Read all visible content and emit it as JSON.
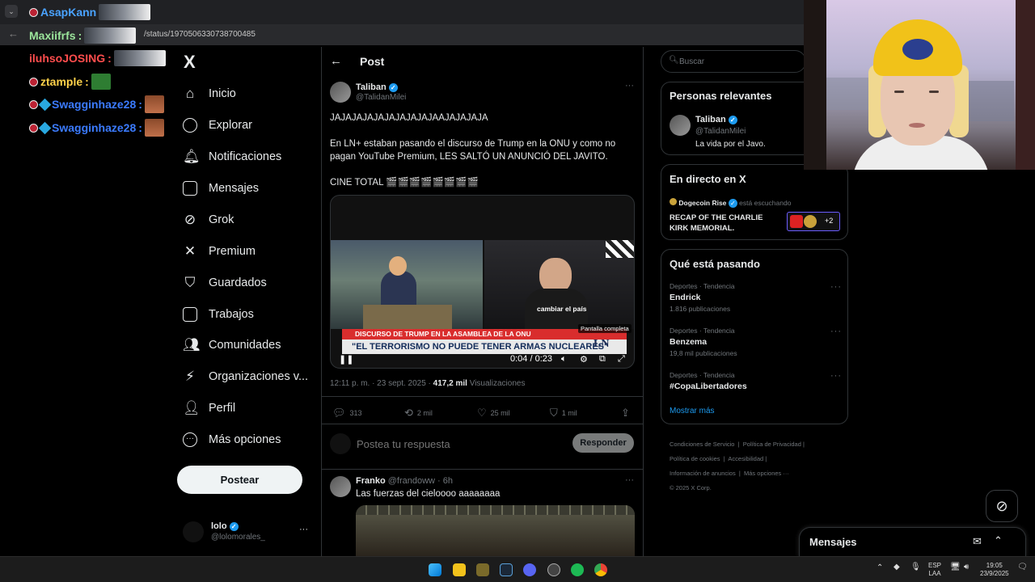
{
  "browser": {
    "url": "/status/1970506330738700485"
  },
  "chat": [
    {
      "user": "AsapKann",
      "color": "#4aa3ff"
    },
    {
      "user": "Maxiifrfs",
      "color": "#9be59b"
    },
    {
      "user": "iluhsoJOSING",
      "color": "#ff4d4d"
    },
    {
      "user": "ztample",
      "color": "#ffd24a"
    },
    {
      "user": "Swagginhaze28",
      "color": "#3b7bff"
    },
    {
      "user": "Swagginhaze28",
      "color": "#3b7bff"
    }
  ],
  "nav": {
    "logo": "X",
    "items": [
      {
        "label": "Inicio",
        "icon": "home-icon"
      },
      {
        "label": "Explorar",
        "icon": "search-icon"
      },
      {
        "label": "Notificaciones",
        "icon": "bell-icon"
      },
      {
        "label": "Mensajes",
        "icon": "mail-icon"
      },
      {
        "label": "Grok",
        "icon": "grok-icon"
      },
      {
        "label": "Premium",
        "icon": "x-icon"
      },
      {
        "label": "Guardados",
        "icon": "bookmark-icon"
      },
      {
        "label": "Trabajos",
        "icon": "briefcase-icon"
      },
      {
        "label": "Comunidades",
        "icon": "people-icon"
      },
      {
        "label": "Organizaciones v...",
        "icon": "lightning-icon"
      },
      {
        "label": "Perfil",
        "icon": "person-icon"
      },
      {
        "label": "Más opciones",
        "icon": "more-circle-icon"
      }
    ],
    "post_button": "Postear",
    "account": {
      "name": "lolo",
      "handle": "@lolomorales_"
    }
  },
  "main": {
    "header": "Post",
    "tweet": {
      "author": "Taliban",
      "handle": "@TalidanMilei",
      "line1": "JAJAJAJAJAJAJAJAJAJAAJAJAJAJA",
      "line2": "En LN+ estaban pasando el discurso de Trump en la ONU y como no pagan YouTube Premium, LES SALTÓ UN ANUNCIÓ DEL JAVITO.",
      "line3": "CINE TOTAL 🎬🎬🎬🎬🎬🎬🎬🎬",
      "meta_time": "12:11 p. m. · 23 sept. 2025 · ",
      "meta_views": "417,2 mil",
      "meta_views_label": " Visualizaciones",
      "replies": "313",
      "reposts": "2 mil",
      "likes": "25 mil",
      "bookmarks": "1 mil"
    },
    "video": {
      "caption": "cambiar el país",
      "ticker_top": "DISCURSO DE TRUMP EN LA ASAMBLEA DE LA ONU",
      "ticker_main": "\"EL TERRORISMO NO PUEDE TENER ARMAS NUCLEARES\"",
      "channel": "LN",
      "time": "0:04 / 0:23",
      "tooltip": "Pantalla completa"
    },
    "reply_placeholder": "Postea tu respuesta",
    "reply_button": "Responder",
    "reply": {
      "author": "Franko",
      "handle": "@frandoww · 6h",
      "text": "Las fuerzas del cieloooo aaaaaaaa"
    }
  },
  "right": {
    "search_placeholder": "Buscar",
    "relevant": {
      "title": "Personas relevantes",
      "name": "Taliban",
      "handle": "@TalidanMilei",
      "bio": "La vida por el Javo."
    },
    "live": {
      "title": "En directo en X",
      "host": "Dogecoin Rise",
      "status": "está escuchando",
      "event": "RECAP OF THE CHARLIE KIRK MEMORIAL.",
      "extra": "+2"
    },
    "trends": {
      "title": "Qué está pasando",
      "items": [
        {
          "category": "Deportes · Tendencia",
          "name": "Endrick",
          "count": "1.816 publicaciones"
        },
        {
          "category": "Deportes · Tendencia",
          "name": "Benzema",
          "count": "19,8 mil publicaciones"
        },
        {
          "category": "Deportes · Tendencia",
          "name": "#CopaLibertadores",
          "count": ""
        }
      ],
      "show_more": "Mostrar más"
    },
    "footer": {
      "l1": "Condiciones de Servicio",
      "l2": "Política de Privacidad",
      "l3": "Política de cookies",
      "l4": "Accesibilidad",
      "l5": "Información de anuncios",
      "l6": "Más opciones ···",
      "l7": "© 2025 X Corp."
    }
  },
  "messages_drawer": "Mensajes",
  "taskbar": {
    "lang1": "ESP",
    "lang2": "LAA",
    "time": "19:05",
    "date": "23/9/2025"
  }
}
